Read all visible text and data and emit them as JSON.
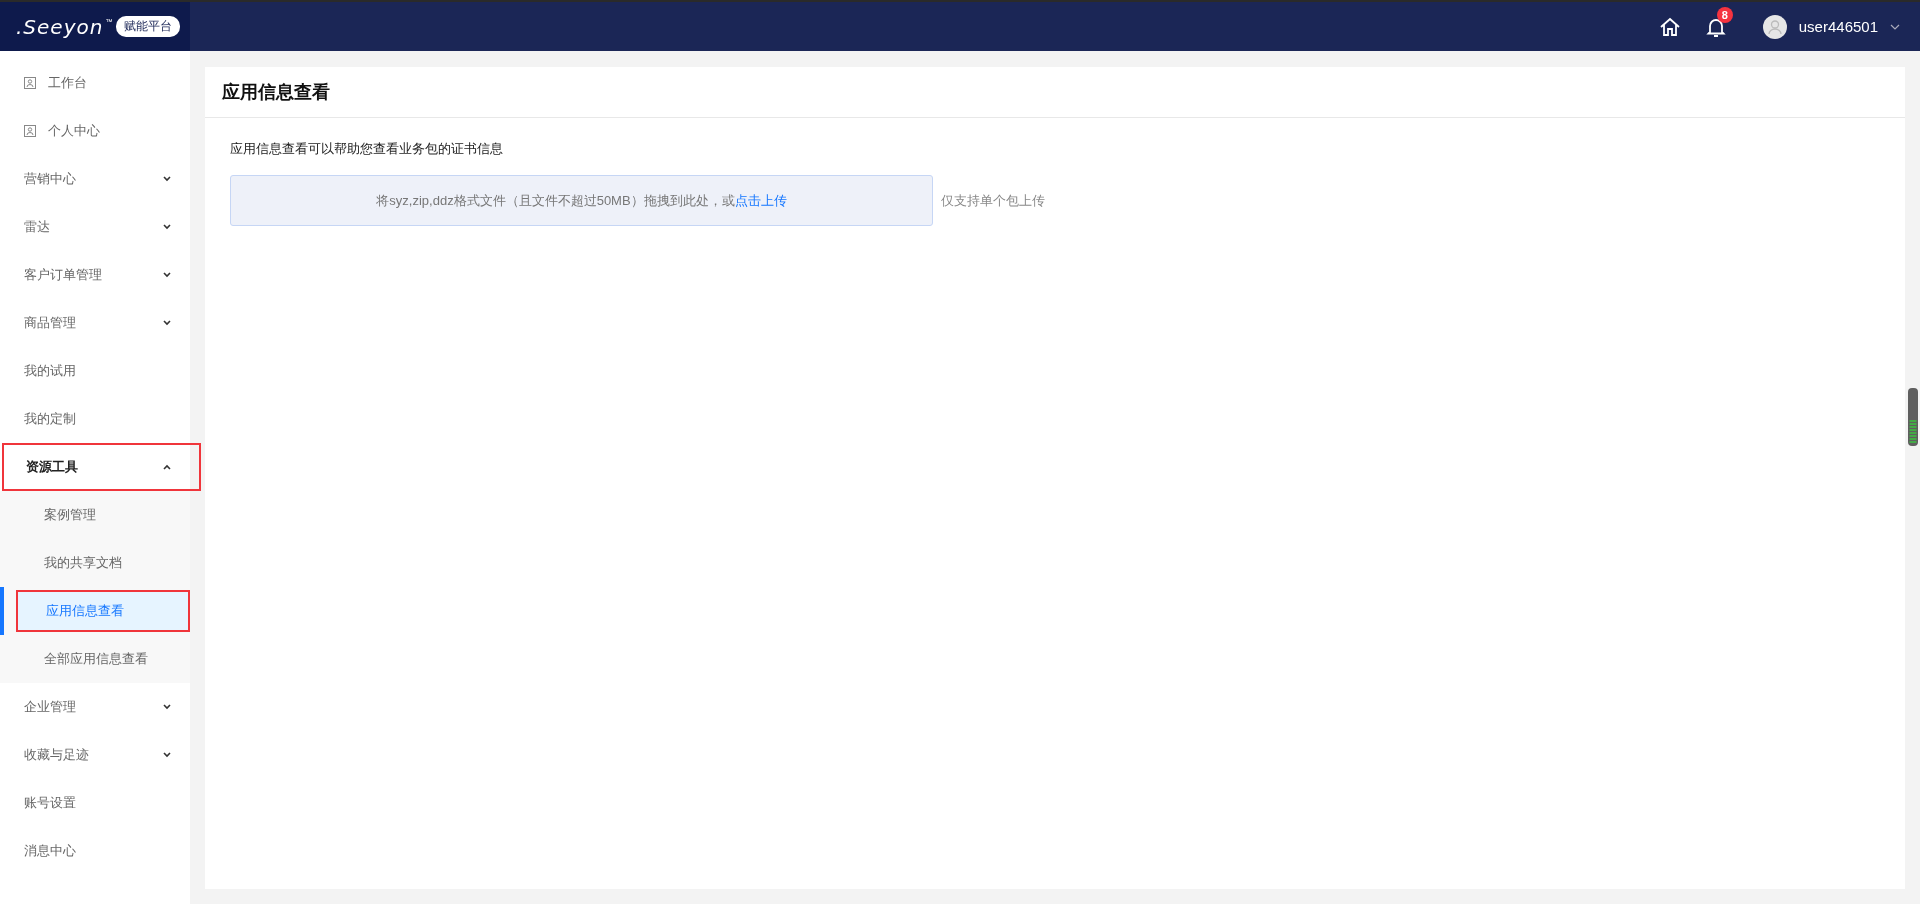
{
  "header": {
    "logo": ".Seeyon",
    "trademark": "™",
    "platform_badge": "赋能平台",
    "notification_count": "8",
    "username": "user446501"
  },
  "sidebar": {
    "items": [
      {
        "label": "工作台",
        "kind": "icon",
        "annotated": false
      },
      {
        "label": "个人中心",
        "kind": "icon",
        "annotated": false
      },
      {
        "label": "营销中心",
        "kind": "group",
        "expanded": false,
        "annotated": false
      },
      {
        "label": "雷达",
        "kind": "group",
        "expanded": false,
        "annotated": false
      },
      {
        "label": "客户订单管理",
        "kind": "group",
        "expanded": false,
        "annotated": false
      },
      {
        "label": "商品管理",
        "kind": "group",
        "expanded": false,
        "annotated": false
      },
      {
        "label": "我的试用",
        "kind": "plain",
        "annotated": false
      },
      {
        "label": "我的定制",
        "kind": "plain",
        "annotated": false
      },
      {
        "label": "资源工具",
        "kind": "group",
        "expanded": true,
        "annotated": true,
        "children": [
          {
            "label": "案例管理",
            "selected": false,
            "annotated": false
          },
          {
            "label": "我的共享文档",
            "selected": false,
            "annotated": false
          },
          {
            "label": "应用信息查看",
            "selected": true,
            "annotated": true
          },
          {
            "label": "全部应用信息查看",
            "selected": false,
            "annotated": false
          }
        ]
      },
      {
        "label": "企业管理",
        "kind": "group",
        "expanded": false,
        "annotated": false
      },
      {
        "label": "收藏与足迹",
        "kind": "group",
        "expanded": false,
        "annotated": false
      },
      {
        "label": "账号设置",
        "kind": "plain",
        "annotated": false
      },
      {
        "label": "消息中心",
        "kind": "plain",
        "annotated": false
      }
    ]
  },
  "page": {
    "title": "应用信息查看",
    "description": "应用信息查看可以帮助您查看业务包的证书信息",
    "upload": {
      "hint": "将syz,zip,ddz格式文件（且文件不超过50MB）拖拽到此处，或",
      "link": "点击上传",
      "note": "仅支持单个包上传"
    }
  }
}
